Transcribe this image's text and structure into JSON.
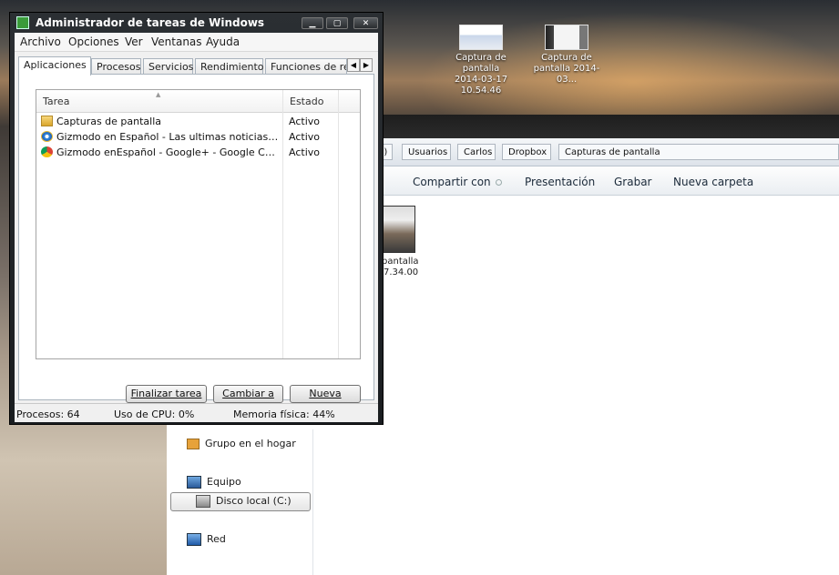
{
  "desktop": {
    "icons": [
      {
        "label_lines": [
          "Captura de",
          "pantalla",
          "2014-03-17",
          "10.54.46"
        ]
      },
      {
        "label_lines": [
          "Captura de",
          "pantalla 2014-03..."
        ]
      }
    ]
  },
  "explorer": {
    "breadcrumbs": [
      ":)",
      "Usuarios",
      "Carlos",
      "Dropbox",
      "Capturas de pantalla"
    ],
    "commands": {
      "share": "Compartir con",
      "slideshow": "Presentación",
      "burn": "Grabar",
      "new_folder": "Nueva carpeta"
    },
    "nav": {
      "homegroup": "Grupo en el hogar",
      "computer": "Equipo",
      "local_disk": "Disco local (C:)",
      "network": "Red"
    },
    "file": {
      "label_line1": "pantalla",
      "label_line2": "7.34.00"
    }
  },
  "task_manager": {
    "title": "Administrador de tareas de Windows",
    "window_controls": {
      "minimize": "▁",
      "maximize": "▢",
      "close": "✕"
    },
    "menu": [
      "Archivo",
      "Opciones",
      "Ver",
      "Ventanas",
      "Ayuda"
    ],
    "tabs": [
      "Aplicaciones",
      "Procesos",
      "Servicios",
      "Rendimiento",
      "Funciones de re"
    ],
    "active_tab": "Aplicaciones",
    "columns": {
      "task": "Tarea",
      "status": "Estado"
    },
    "rows": [
      {
        "task": "Capturas de pantalla",
        "status": "Activo",
        "icon": "folder-icon"
      },
      {
        "task": "Gizmodo en Español - Las ultimas noticias en tecnología",
        "status": "Activo",
        "icon": "ie-icon"
      },
      {
        "task": "Gizmodo enEspañol - Google+ - Google Chrome",
        "status": "Activo",
        "icon": "chrome-icon"
      }
    ],
    "buttons": {
      "end_task": "Finalizar tarea",
      "switch_to": "Cambiar a",
      "new_task": "Nueva tarea..."
    },
    "statusbar": {
      "processes": "Procesos: 64",
      "cpu": "Uso de CPU: 0%",
      "memory": "Memoria física: 44%"
    }
  }
}
